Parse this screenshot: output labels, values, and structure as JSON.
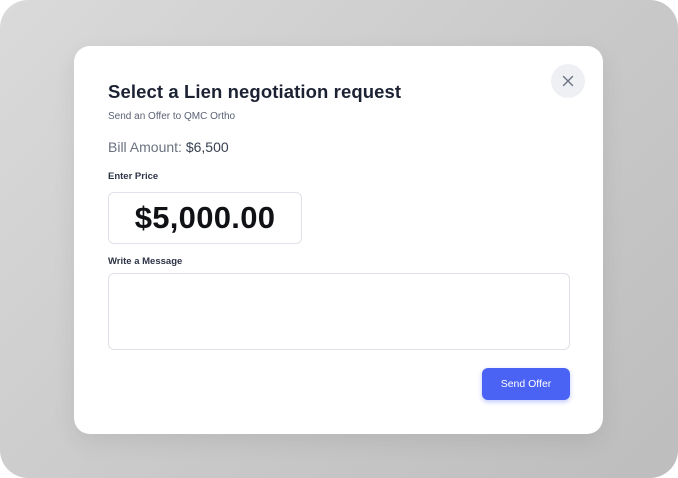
{
  "dialog": {
    "title": "Select a Lien negotiation request",
    "subtitle": "Send an Offer to QMC Ortho",
    "bill_label": "Bill Amount:",
    "bill_amount": "$6,500",
    "price_label": "Enter Price",
    "price_value": "$5,000.00",
    "message_label": "Write a Message",
    "message_value": "",
    "send_button": "Send Offer",
    "close_icon": "close-icon"
  },
  "colors": {
    "accent": "#4b63f5",
    "backdrop": "#c9c9c9"
  }
}
